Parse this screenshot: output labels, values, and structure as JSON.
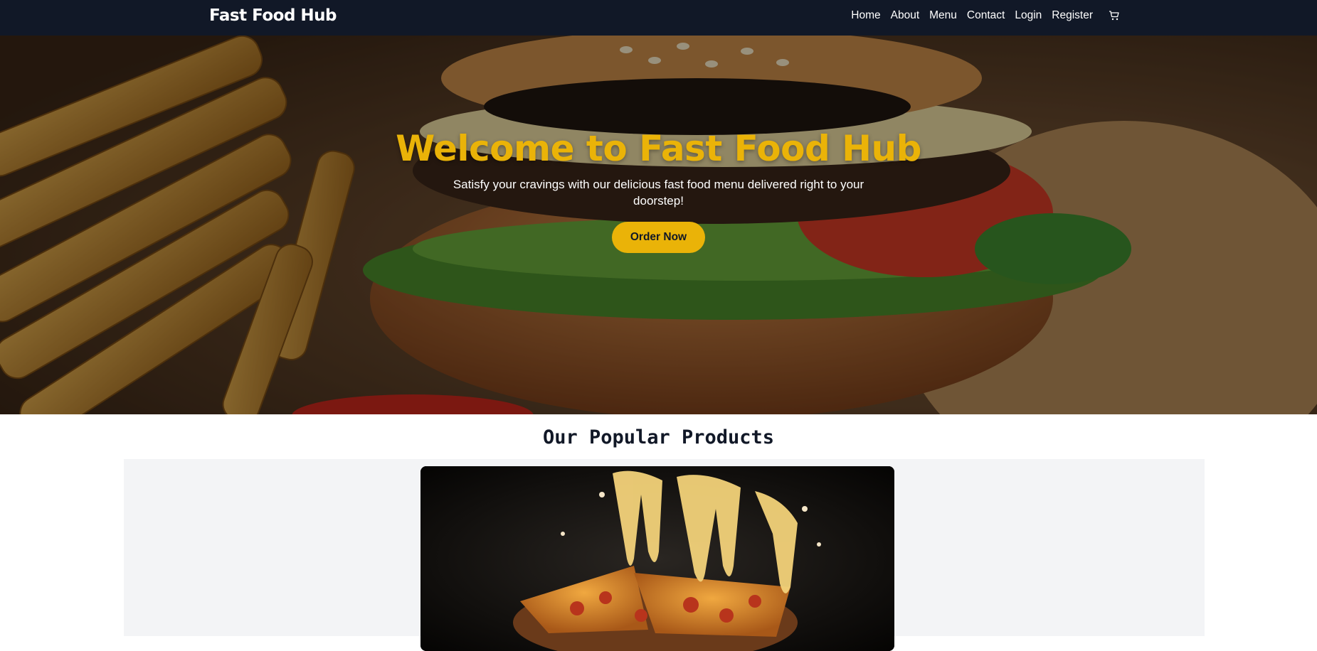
{
  "navbar": {
    "brand": "Fast Food Hub",
    "links": [
      "Home",
      "About",
      "Menu",
      "Contact",
      "Login",
      "Register"
    ],
    "cart_icon": "cart-icon"
  },
  "hero": {
    "title": "Welcome to Fast Food Hub",
    "subtitle": "Satisfy your cravings with our delicious fast food menu delivered right to your doorstep!",
    "button_label": "Order Now",
    "background_image": "burger-and-fries-photo"
  },
  "popular": {
    "title": "Our Popular Products",
    "products": [
      {
        "image": "pizza-photo"
      }
    ]
  },
  "colors": {
    "navbar_bg": "#111827",
    "accent": "#eab308",
    "section_bg": "#f3f4f6"
  }
}
